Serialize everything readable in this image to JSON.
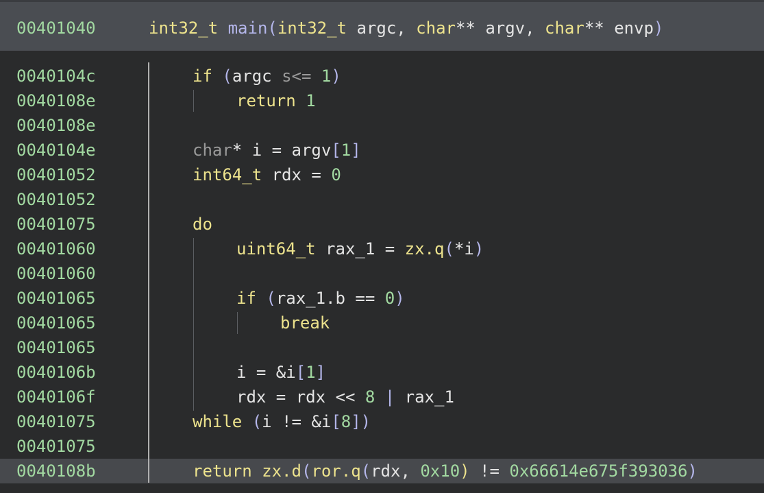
{
  "header": {
    "address": "00401040",
    "return_type": "int32_t",
    "function_name": "main",
    "params": [
      {
        "type": "int32_t",
        "name": "argc"
      },
      {
        "type": "char",
        "ptr": "**",
        "name": "argv"
      },
      {
        "type": "char",
        "ptr": "**",
        "name": "envp"
      }
    ]
  },
  "lines": [
    {
      "address": "0040104c",
      "text": "if (argc s<= 1)"
    },
    {
      "address": "0040108e",
      "text": "return 1"
    },
    {
      "address": "0040108e",
      "text": ""
    },
    {
      "address": "0040104e",
      "text": "char* i = argv[1]"
    },
    {
      "address": "00401052",
      "text": "int64_t rdx = 0"
    },
    {
      "address": "00401052",
      "text": ""
    },
    {
      "address": "00401075",
      "text": "do"
    },
    {
      "address": "00401060",
      "text": "uint64_t rax_1 = zx.q(*i)"
    },
    {
      "address": "00401060",
      "text": ""
    },
    {
      "address": "00401065",
      "text": "if (rax_1.b == 0)"
    },
    {
      "address": "00401065",
      "text": "break"
    },
    {
      "address": "00401065",
      "text": ""
    },
    {
      "address": "0040106b",
      "text": "i = &i[1]"
    },
    {
      "address": "0040106f",
      "text": "rdx = rdx << 8 | rax_1"
    },
    {
      "address": "00401075",
      "text": "while (i != &i[8])"
    },
    {
      "address": "00401075",
      "text": ""
    },
    {
      "address": "0040108b",
      "text": "return zx.d(ror.q(rdx, 0x10) != 0x66614e675f393036)"
    }
  ],
  "selected_line_address": "0040108b",
  "colors": {
    "background": "#2a2b2c",
    "header_background": "#4a4d52",
    "highlight_background": "#47494d",
    "address": "#a2d9a1",
    "keyword": "#ede38d",
    "punctuation": "#b4b6ea",
    "text": "#e4e4e4"
  }
}
